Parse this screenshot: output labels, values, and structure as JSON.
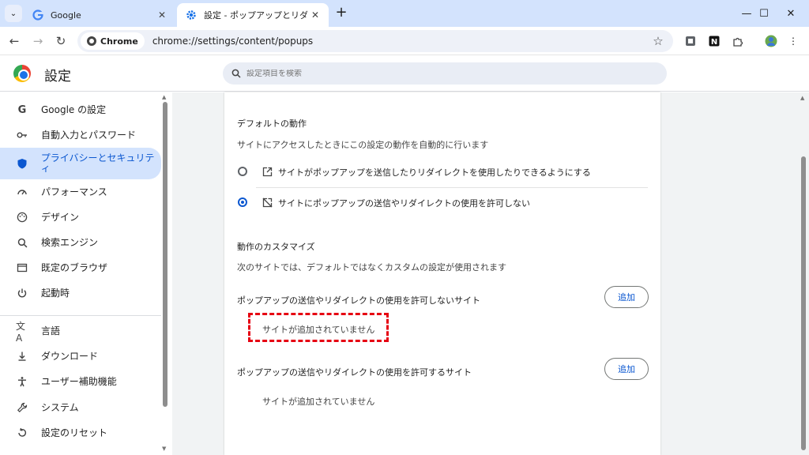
{
  "browser": {
    "tabs": [
      {
        "title": "Google",
        "icon": "google-icon",
        "active": false
      },
      {
        "title": "設定 - ポップアップとリダイレクト",
        "icon": "gear-icon",
        "active": true
      }
    ],
    "omnibox": {
      "chip_label": "Chrome",
      "url": "chrome://settings/content/popups"
    }
  },
  "settings": {
    "title": "設定",
    "search_placeholder": "設定項目を検索"
  },
  "sidebar": {
    "items": [
      {
        "label": "Google の設定",
        "icon": "google-icon"
      },
      {
        "label": "自動入力とパスワード",
        "icon": "key-icon"
      },
      {
        "label": "プライバシーとセキュリティ",
        "icon": "shield-icon",
        "active": true
      },
      {
        "label": "パフォーマンス",
        "icon": "gauge-icon"
      },
      {
        "label": "デザイン",
        "icon": "palette-icon"
      },
      {
        "label": "検索エンジン",
        "icon": "search-icon"
      },
      {
        "label": "既定のブラウザ",
        "icon": "browser-window-icon"
      },
      {
        "label": "起動時",
        "icon": "power-icon"
      },
      {
        "label": "言語",
        "icon": "translate-icon"
      },
      {
        "label": "ダウンロード",
        "icon": "download-icon"
      },
      {
        "label": "ユーザー補助機能",
        "icon": "accessibility-icon"
      },
      {
        "label": "システム",
        "icon": "wrench-icon"
      },
      {
        "label": "設定のリセット",
        "icon": "reset-icon"
      }
    ]
  },
  "content": {
    "default_heading": "デフォルトの動作",
    "default_desc": "サイトにアクセスしたときにこの設定の動作を自動的に行います",
    "option_allow": "サイトがポップアップを送信したりリダイレクトを使用したりできるようにする",
    "option_block": "サイトにポップアップの送信やリダイレクトの使用を許可しない",
    "selected_option": "option_block",
    "custom_heading": "動作のカスタマイズ",
    "custom_desc": "次のサイトでは、デフォルトではなくカスタムの設定が使用されます",
    "block_list_title": "ポップアップの送信やリダイレクトの使用を許可しないサイト",
    "block_list_empty": "サイトが追加されていません",
    "allow_list_title": "ポップアップの送信やリダイレクトの使用を許可するサイト",
    "allow_list_empty": "サイトが追加されていません",
    "add_label": "追加"
  },
  "colors": {
    "accent": "#0b57d0",
    "highlight": "#e60012"
  }
}
